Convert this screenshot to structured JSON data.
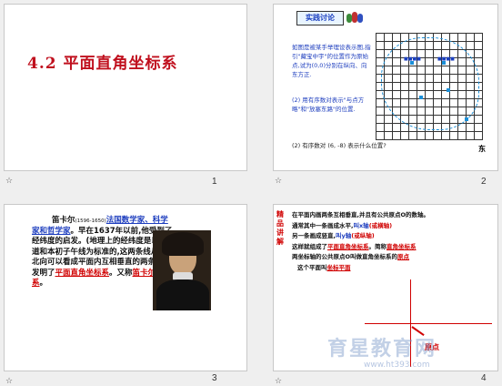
{
  "slides": [
    {
      "title": "4.2 平面直角坐标系",
      "number": "1"
    },
    {
      "badge": "实践讨论",
      "text": "如图是被某手举理设表示图,指引\"藏宝中宇\"的位置作为原始点,试为(0,0)分别在纵向、向东方正.",
      "question_1": "(2) 用有序数对表示\"与点方略\"和\"放塞东路\"的位置.",
      "question_2": "(2) 有序数对 (6, -8) 表示什么位置?",
      "east": "东",
      "number": "2"
    },
    {
      "text_prefix": "笛卡尔",
      "years": "(1596-1650)",
      "highlight_1": "法国数学家、科学家和哲学家",
      "body": "。早在1637年以前,他受到了经纬度的启发。(地理上的经纬度是以赤道和本初子午线为标准的,这两条线从南北向可以看成平面内互相垂直的两条线)发明了",
      "highlight_2": "平面直角坐标系",
      "tail": "。又称",
      "highlight_3": "笛卡尔坐标系",
      "end": "。",
      "number": "3"
    },
    {
      "side_label": "精品讲解",
      "line1": "在平面内画两条互相垂直,并且有公共原点O的数轴。",
      "line2_a": "通常其中一条画成水平,",
      "line2_b": "叫x轴",
      "line2_c": "(或横轴)",
      "line3_a": "另一条画成竖直,",
      "line3_b": "叫y轴",
      "line3_c": "(或纵轴)",
      "line4_a": "这样就组成了",
      "line4_b": "平面直角坐标系",
      "line4_c": "。简称",
      "line4_d": "直角坐标系",
      "line5_a": "两坐标轴的公共原点O叫做直角坐标系的",
      "line5_b": "原点",
      "line6_a": "这个平面叫",
      "line6_b": "坐标平面",
      "origin": "原点",
      "number": "4"
    }
  ],
  "watermark": {
    "brand": "育星教育网",
    "url": "www.ht393.com"
  },
  "colors": {
    "title_red": "#c0101e",
    "highlight_red": "#d00000",
    "blue": "#1f3fbf"
  }
}
